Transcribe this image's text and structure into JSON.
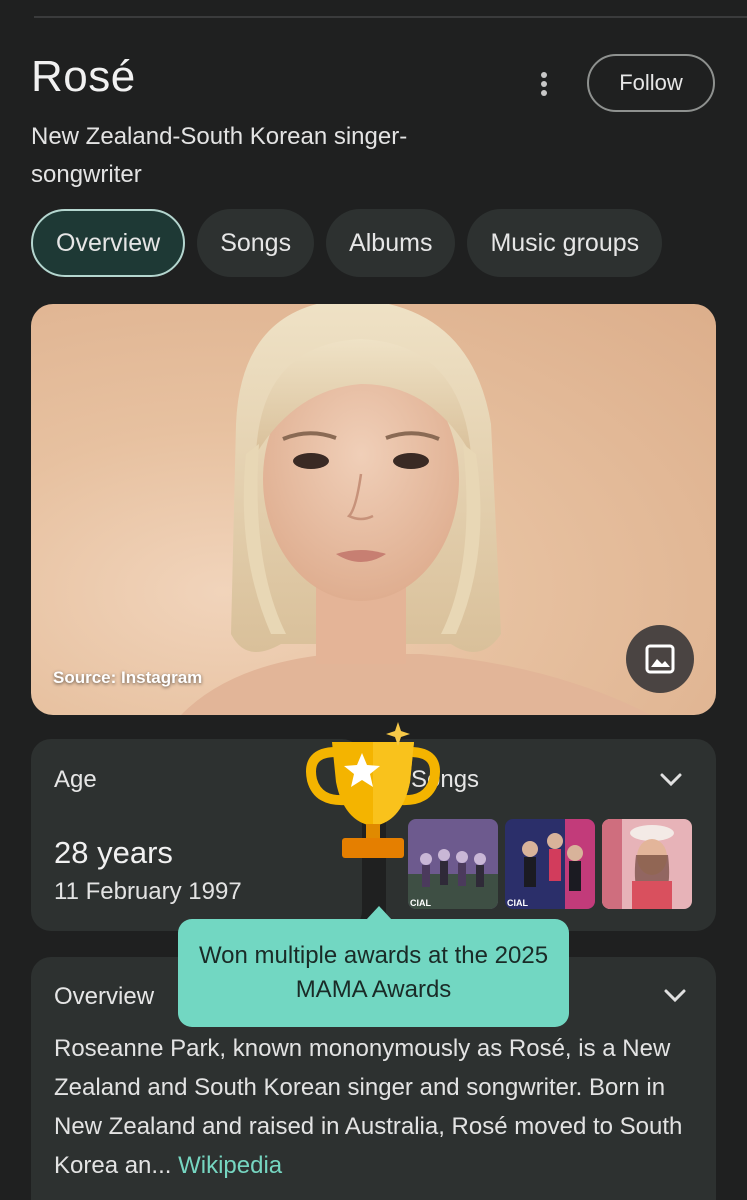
{
  "header": {
    "title": "Rosé",
    "subtitle": "New Zealand-South Korean singer-songwriter",
    "follow_label": "Follow"
  },
  "tabs": [
    {
      "label": "Overview",
      "active": true
    },
    {
      "label": "Songs",
      "active": false
    },
    {
      "label": "Albums",
      "active": false
    },
    {
      "label": "Music groups",
      "active": false
    }
  ],
  "photo": {
    "source_label": "Source: Instagram",
    "button_icon": "image-icon"
  },
  "age_card": {
    "label": "Age",
    "value": "28 years",
    "date": "11 February 1997"
  },
  "songs_card": {
    "label": "Songs",
    "thumbnail_caption": "CIAL",
    "thumbnails": [
      {
        "icon": "music-video-thumbnail"
      },
      {
        "icon": "music-video-thumbnail"
      },
      {
        "icon": "music-video-thumbnail"
      }
    ]
  },
  "overview_card": {
    "label": "Overview",
    "text": "Roseanne Park, known mononymously as Rosé, is a New Zealand and South Korean singer and songwriter. Born in New Zealand and raised in Australia, Rosé moved to South Korea an... ",
    "link_label": "Wikipedia"
  },
  "tooltip": {
    "text": "Won multiple awards at the 2025 MAMA Awards"
  },
  "colors": {
    "background": "#1f2020",
    "card": "#2d3130",
    "accent": "#76d6c1",
    "tooltip": "#72d7c2",
    "trophy": "#f4b400"
  }
}
